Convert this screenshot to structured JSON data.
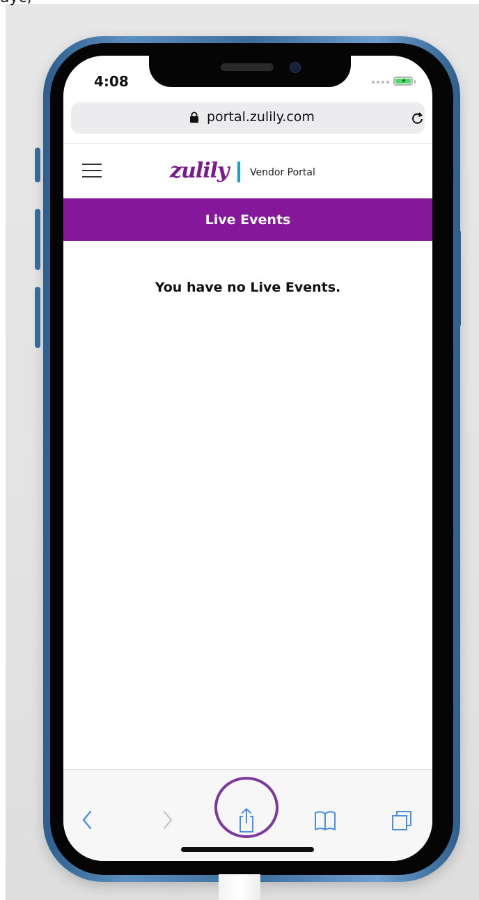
{
  "top_fragment": "ayc,",
  "status_bar": {
    "time": "4:08"
  },
  "address_bar": {
    "url": "portal.zulily.com"
  },
  "site_header": {
    "logo_text": "zulily",
    "portal_label": "Vendor Portal"
  },
  "banner": {
    "title": "Live Events"
  },
  "content": {
    "empty_message": "You have no Live Events."
  },
  "colors": {
    "brand_purple": "#85179a",
    "divider_blue": "#1aa0d2",
    "safari_blue": "#4a8fe2",
    "highlight_ring": "#7c3a9d"
  },
  "toolbar": {
    "icons": [
      "back-icon",
      "forward-icon",
      "share-icon",
      "bookmarks-icon",
      "tabs-icon"
    ]
  }
}
